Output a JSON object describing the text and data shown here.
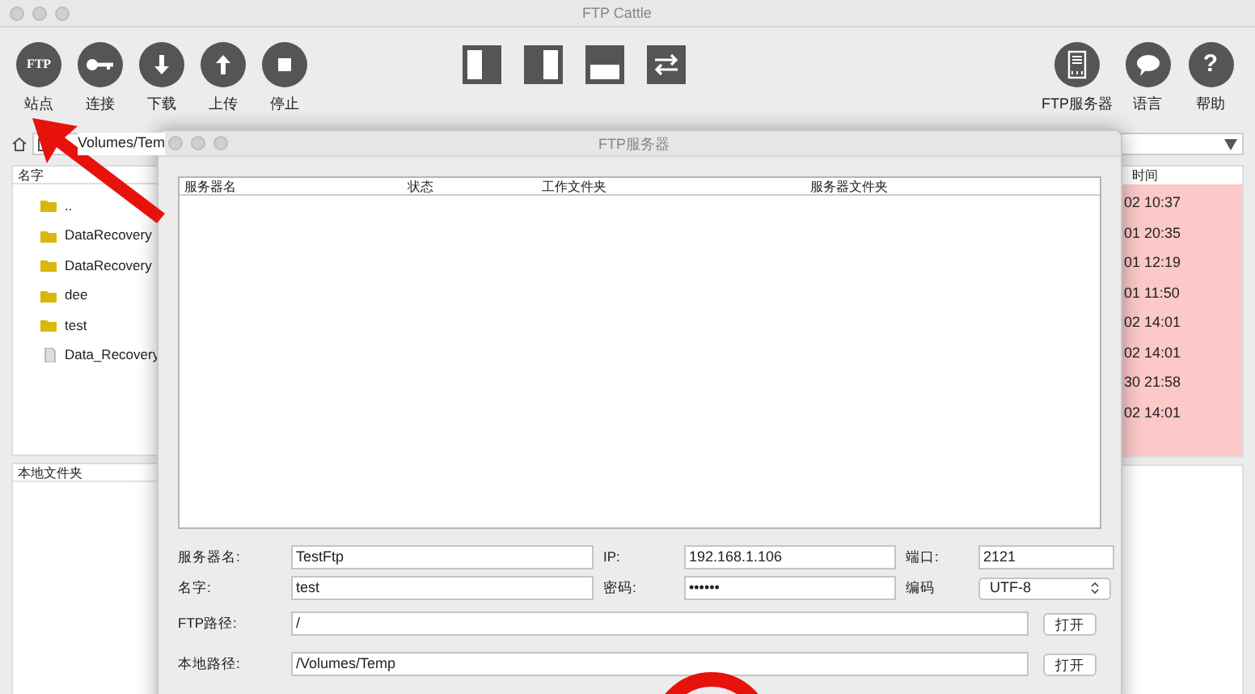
{
  "window": {
    "title": "FTP Cattle"
  },
  "toolbar": {
    "left": [
      {
        "kind": "ftp",
        "icon_text": "FTP",
        "label": "站点"
      },
      {
        "kind": "key",
        "label": "连接"
      },
      {
        "kind": "download",
        "label": "下载"
      },
      {
        "kind": "upload",
        "label": "上传"
      },
      {
        "kind": "stop",
        "label": "停止"
      }
    ],
    "center": [
      {
        "kind": "left-pane"
      },
      {
        "kind": "right-pane"
      },
      {
        "kind": "bottom-pane"
      },
      {
        "kind": "swap"
      }
    ],
    "right": [
      {
        "kind": "server",
        "label": "FTP服务器"
      },
      {
        "kind": "chat",
        "label": "语言"
      },
      {
        "kind": "help",
        "icon_text": "?",
        "label": "帮助"
      }
    ]
  },
  "local_pane": {
    "path": "Volumes/Tem",
    "column_1": "名字",
    "files": [
      {
        "kind": "folder",
        "name": ".."
      },
      {
        "kind": "folder",
        "name": "DataRecovery"
      },
      {
        "kind": "folder",
        "name": "DataRecovery"
      },
      {
        "kind": "folder",
        "name": "dee"
      },
      {
        "kind": "folder",
        "name": "test"
      },
      {
        "kind": "file",
        "name": "Data_Recovery"
      }
    ],
    "bottom_header": "本地文件夹"
  },
  "remote_pane": {
    "column_header": "时间",
    "times": [
      "02 10:37",
      "01 20:35",
      "01 12:19",
      "01 11:50",
      "02 14:01",
      "02 14:01",
      "30 21:58",
      "02 14:01"
    ]
  },
  "dialog": {
    "title": "FTP服务器",
    "columns": [
      "服务器名",
      "状态",
      "工作文件夹",
      "服务器文件夹"
    ],
    "rows": [
      {
        "fields": [
          {
            "label": "服务器名:",
            "value": "TestFtp",
            "kind": "text"
          },
          {
            "label": "IP:",
            "value": "192.168.1.106",
            "kind": "text"
          },
          {
            "label": "端口:",
            "value": "2121",
            "kind": "text"
          }
        ]
      },
      {
        "fields": [
          {
            "label": "名字:",
            "value": "test",
            "kind": "text"
          },
          {
            "label": "密码:",
            "value": "••••••",
            "kind": "password"
          },
          {
            "label": "编码",
            "value": "UTF-8",
            "kind": "select"
          }
        ]
      },
      {
        "fields": [
          {
            "label": "FTP路径:",
            "value": "/",
            "kind": "text"
          }
        ],
        "button": "打开"
      },
      {
        "fields": [
          {
            "label": "本地路径:",
            "value": "/Volumes/Temp",
            "kind": "text"
          }
        ],
        "button": "打开"
      }
    ]
  }
}
